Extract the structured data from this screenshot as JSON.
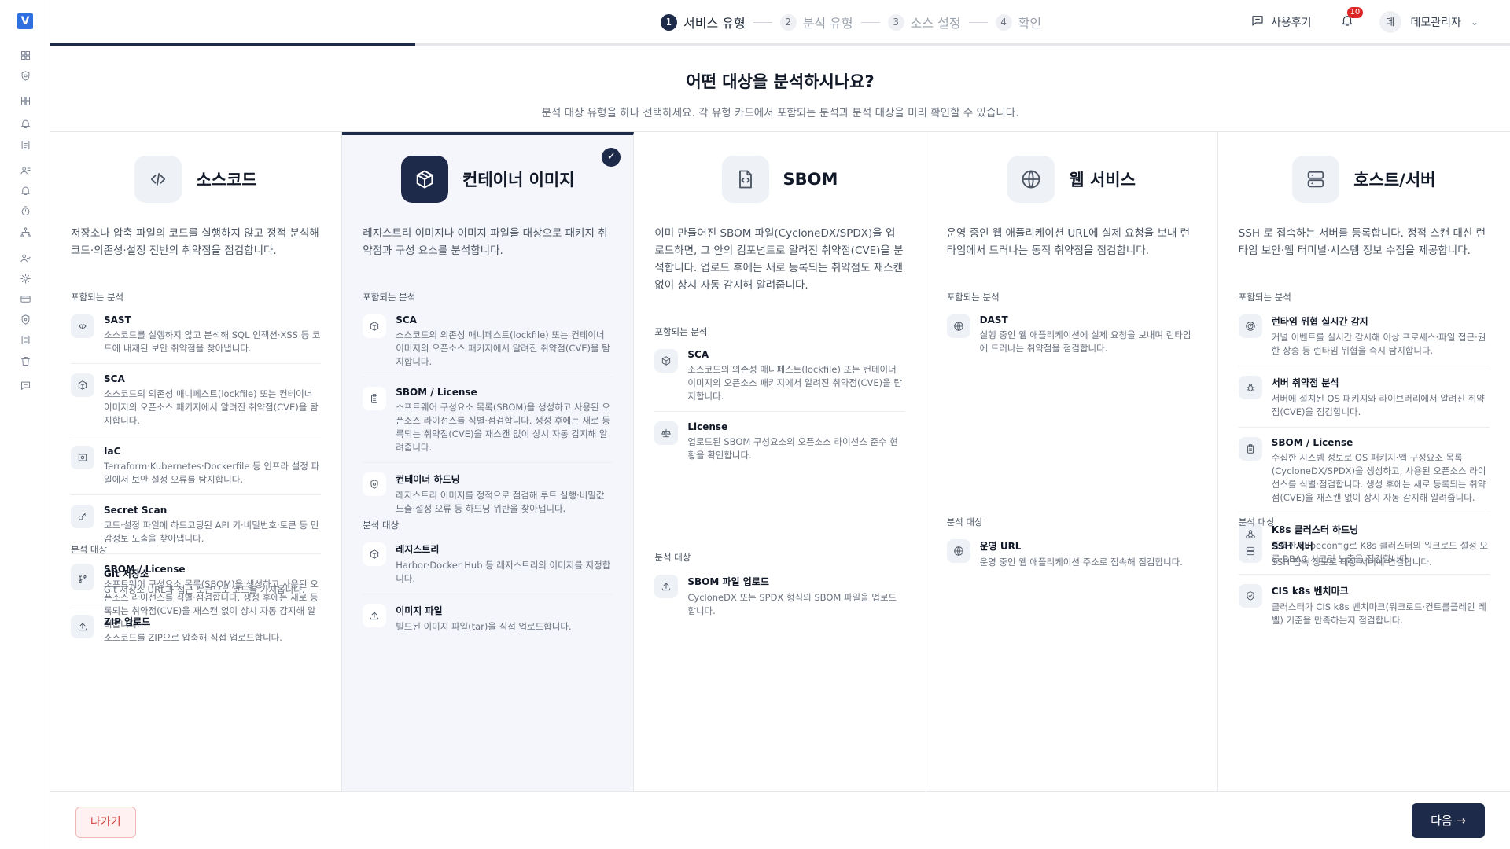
{
  "app": {
    "logo": "V"
  },
  "rail": {
    "icons": [
      "dashboard-icon",
      "shield-icon",
      "grid-icon",
      "alarm-icon",
      "report-icon",
      "user-group-icon",
      "bell-icon",
      "timer-icon",
      "network-icon",
      "user-check-icon",
      "gear-icon",
      "card-icon",
      "shield-lock-icon",
      "list-icon",
      "trash-icon",
      "message-icon"
    ]
  },
  "stepper": {
    "steps": [
      {
        "num": "1",
        "label": "서비스 유형"
      },
      {
        "num": "2",
        "label": "분석 유형"
      },
      {
        "num": "3",
        "label": "소스 설정"
      },
      {
        "num": "4",
        "label": "확인"
      }
    ],
    "progress": 0.25
  },
  "header": {
    "review": "사용후기",
    "notifications": "10",
    "avatar": "데",
    "user": "데모관리자"
  },
  "intro": {
    "title": "어떤 대상을 분석하시나요?",
    "subtitle": "분석 대상 유형을 하나 선택하세요. 각 유형 카드에서 포함되는 분석과 분석 대상을 미리 확인할 수 있습니다."
  },
  "cards": [
    {
      "title": "소스코드",
      "icon": "code-icon",
      "desc": "저장소나 압축 파일의 코드를 실행하지 않고 정적 분석해 코드·의존성·설정 전반의 취약점을 점검합니다.",
      "analysis_label": "포함되는 분석",
      "analyses": [
        {
          "title": "SAST",
          "icon": "code-icon",
          "desc": "소스코드를 실행하지 않고 분석해 SQL 인젝션·XSS 등 코드에 내재된 보안 취약점을 찾아냅니다."
        },
        {
          "title": "SCA",
          "icon": "package-icon",
          "desc": "소스코드의 의존성 매니페스트(lockfile) 또는 컨테이너 이미지의 오픈소스 패키지에서 알려진 취약점(CVE)을 탐지합니다."
        },
        {
          "title": "IaC",
          "icon": "server-config-icon",
          "desc": "Terraform·Kubernetes·Dockerfile 등 인프라 설정 파일에서 보안 설정 오류를 탐지합니다."
        },
        {
          "title": "Secret Scan",
          "icon": "key-icon",
          "desc": "코드·설정 파일에 하드코딩된 API 키·비밀번호·토큰 등 민감정보 노출을 찾아냅니다."
        },
        {
          "title": "SBOM / License",
          "icon": "clipboard-icon",
          "desc": "소프트웨어 구성요소 목록(SBOM)을 생성하고 사용된 오픈소스 라이선스를 식별·점검합니다. 생성 후에는 새로 등록되는 취약점(CVE)을 재스캔 없이 상시 자동 감지해 알려줍니다."
        }
      ],
      "target_label": "분석 대상",
      "targets": [
        {
          "title": "Git 저장소",
          "icon": "git-branch-icon",
          "desc": "Git 저장소 URL과 접근 토큰으로 코드를 가져옵니다."
        },
        {
          "title": "ZIP 업로드",
          "icon": "upload-icon",
          "desc": "소스코드를 ZIP으로 압축해 직접 업로드합니다."
        }
      ]
    },
    {
      "title": "컨테이너 이미지",
      "icon": "container-icon",
      "selected": true,
      "desc": "레지스트리 이미지나 이미지 파일을 대상으로 패키지 취약점과 구성 요소를 분석합니다.",
      "analysis_label": "포함되는 분석",
      "analyses": [
        {
          "title": "SCA",
          "icon": "package-icon",
          "desc": "소스코드의 의존성 매니페스트(lockfile) 또는 컨테이너 이미지의 오픈소스 패키지에서 알려진 취약점(CVE)을 탐지합니다."
        },
        {
          "title": "SBOM / License",
          "icon": "clipboard-icon",
          "desc": "소프트웨어 구성요소 목록(SBOM)을 생성하고 사용된 오픈소스 라이선스를 식별·점검합니다. 생성 후에는 새로 등록되는 취약점(CVE)을 재스캔 없이 상시 자동 감지해 알려줍니다."
        },
        {
          "title": "컨테이너 하드닝",
          "icon": "shield-icon",
          "desc": "레지스트리 이미지를 정적으로 점검해 루트 실행·비밀값 노출·설정 오류 등 하드닝 위반을 찾아냅니다."
        }
      ],
      "target_label": "분석 대상",
      "targets": [
        {
          "title": "레지스트리",
          "icon": "package-icon",
          "desc": "Harbor·Docker Hub 등 레지스트리의 이미지를 지정합니다."
        },
        {
          "title": "이미지 파일",
          "icon": "upload-icon",
          "desc": "빌드된 이미지 파일(tar)을 직접 업로드합니다."
        }
      ]
    },
    {
      "title": "SBOM",
      "icon": "file-code-icon",
      "desc": "이미 만들어진 SBOM 파일(CycloneDX/SPDX)을 업로드하면, 그 안의 컴포넌트로 알려진 취약점(CVE)을 분석합니다. 업로드 후에는 새로 등록되는 취약점도 재스캔 없이 상시 자동 감지해 알려줍니다.",
      "analysis_label": "포함되는 분석",
      "analyses": [
        {
          "title": "SCA",
          "icon": "package-icon",
          "desc": "소스코드의 의존성 매니페스트(lockfile) 또는 컨테이너 이미지의 오픈소스 패키지에서 알려진 취약점(CVE)을 탐지합니다."
        },
        {
          "title": "License",
          "icon": "scale-icon",
          "desc": "업로드된 SBOM 구성요소의 오픈소스 라이선스 준수 현황을 확인합니다."
        }
      ],
      "target_label": "분석 대상",
      "targets": [
        {
          "title": "SBOM 파일 업로드",
          "icon": "upload-icon",
          "desc": "CycloneDX 또는 SPDX 형식의 SBOM 파일을 업로드합니다."
        }
      ]
    },
    {
      "title": "웹 서비스",
      "icon": "globe-icon",
      "desc": "운영 중인 웹 애플리케이션 URL에 실제 요청을 보내 런타임에서 드러나는 동적 취약점을 점검합니다.",
      "analysis_label": "포함되는 분석",
      "analyses": [
        {
          "title": "DAST",
          "icon": "globe-icon",
          "desc": "실행 중인 웹 애플리케이션에 실제 요청을 보내며 런타임에 드러나는 취약점을 점검합니다."
        }
      ],
      "target_label": "분석 대상",
      "targets": [
        {
          "title": "운영 URL",
          "icon": "globe-icon",
          "desc": "운영 중인 웹 애플리케이션 주소로 접속해 점검합니다."
        }
      ]
    },
    {
      "title": "호스트/서버",
      "icon": "server-icon",
      "desc": "SSH 로 접속하는 서버를 등록합니다. 정적 스캔 대신 런타임 보안·웹 터미널·시스템 정보 수집을 제공합니다.",
      "analysis_label": "포함되는 분석",
      "analyses": [
        {
          "title": "런타임 위협 실시간 감지",
          "icon": "radar-icon",
          "desc": "커널 이벤트를 실시간 감시해 이상 프로세스·파일 접근·권한 상승 등 런타임 위협을 즉시 탐지합니다."
        },
        {
          "title": "서버 취약점 분석",
          "icon": "bug-icon",
          "desc": "서버에 설치된 OS 패키지와 라이브러리에서 알려진 취약점(CVE)을 점검합니다."
        },
        {
          "title": "SBOM / License",
          "icon": "clipboard-icon",
          "desc": "수집한 시스템 정보로 OS 패키지·앱 구성요소 목록(CycloneDX/SPDX)을 생성하고, 사용된 오픈소스 라이선스를 식별·점검합니다. 생성 후에는 새로 등록되는 취약점(CVE)을 재스캔 없이 상시 자동 감지해 알려줍니다."
        },
        {
          "title": "K8s 클러스터 하드닝",
          "icon": "cluster-icon",
          "desc": "등록한 kubeconfig로 K8s 클러스터의 워크로드 설정 오류·RBAC·시크릿 노출을 점검합니다."
        },
        {
          "title": "CIS k8s 벤치마크",
          "icon": "shield-check-icon",
          "desc": "클러스터가 CIS k8s 벤치마크(워크로드·컨트롤플레인 레벨) 기준을 만족하는지 점검합니다."
        }
      ],
      "target_label": "분석 대상",
      "targets": [
        {
          "title": "SSH 서버",
          "icon": "server-icon",
          "desc": "SSH 접속 정보로 대상 서버에 연결합니다."
        }
      ]
    }
  ],
  "footer": {
    "exit": "나가기",
    "next": "다음 →"
  },
  "colors": {
    "primary": "#1e2a4a",
    "logo": "#2f6fe0",
    "danger": "#d13c3c",
    "badge": "#dc2626"
  }
}
